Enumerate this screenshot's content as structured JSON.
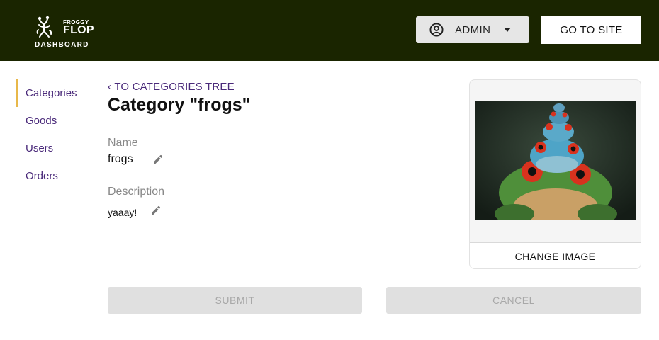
{
  "header": {
    "logo": {
      "brand_top": "FROGGY",
      "brand_main": "FLOP",
      "subtitle": "DASHBOARD"
    },
    "user_menu": {
      "label": "ADMIN",
      "icon": "user-circle-icon"
    },
    "go_to_site": "GO TO SITE"
  },
  "sidebar": {
    "items": [
      {
        "label": "Categories",
        "active": true
      },
      {
        "label": "Goods"
      },
      {
        "label": "Users"
      },
      {
        "label": "Orders"
      }
    ]
  },
  "main": {
    "back_link": "TO CATEGORIES TREE",
    "back_icon": "‹",
    "title": "Category \"frogs\"",
    "name_label": "Name",
    "name_value": "frogs",
    "description_label": "Description",
    "description_value": "yaaay!"
  },
  "image_card": {
    "change_button": "CHANGE IMAGE"
  },
  "actions": {
    "submit": "SUBMIT",
    "cancel": "CANCEL"
  },
  "colors": {
    "header_bg": "#1a2500",
    "nav_link": "#4a2a7a",
    "active_indicator": "#e8b84a",
    "disabled_button": "#e0e0e0"
  }
}
